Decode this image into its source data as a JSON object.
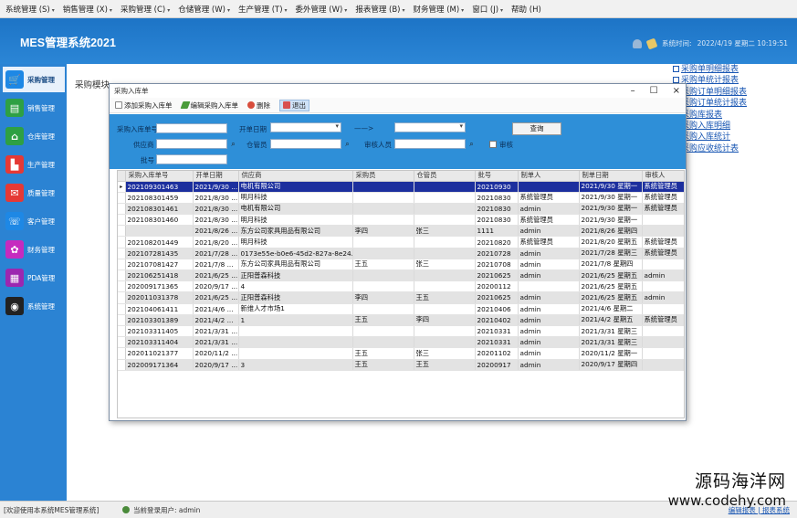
{
  "menu": [
    "系统管理 (S)",
    "销售管理 (X)",
    "采购管理 (C)",
    "仓储管理 (W)",
    "生产管理 (T)",
    "委外管理 (W)",
    "报表管理 (B)",
    "财务管理 (M)",
    "窗口 (J)",
    "帮助 (H)"
  ],
  "header": {
    "title": "MES管理系统2021",
    "login_label": "系统时间:",
    "datetime": "2022/4/19 星期二 10:19:51"
  },
  "sidebar": {
    "items": [
      {
        "label": "采购管理",
        "icon": "cart-icon",
        "color": "#1e88e5"
      },
      {
        "label": "销售管理",
        "icon": "document-icon",
        "color": "#2ea043"
      },
      {
        "label": "仓库管理",
        "icon": "home-icon",
        "color": "#2ea043"
      },
      {
        "label": "生产管理",
        "icon": "factory-icon",
        "color": "#e53935"
      },
      {
        "label": "质量管理",
        "icon": "mail-icon",
        "color": "#e53935"
      },
      {
        "label": "客户管理",
        "icon": "support-icon",
        "color": "#1e88e5"
      },
      {
        "label": "财务管理",
        "icon": "gift-icon",
        "color": "#c62bbf"
      },
      {
        "label": "PDA管理",
        "icon": "calculator-icon",
        "color": "#9c27b0"
      },
      {
        "label": "系统管理",
        "icon": "eye-icon",
        "color": "#222222"
      }
    ]
  },
  "main": {
    "heading": "采购模块",
    "right_links": [
      "采购单明细报表",
      "采购单统计报表",
      "采购订单明细报表",
      "采购订单统计报表",
      "采购库报表",
      "采购入库明细",
      "采购入库统计",
      "采购应收统计表"
    ]
  },
  "dialog": {
    "title": "采购入库单",
    "controls": [
      "–",
      "☐",
      "×"
    ],
    "toolbar": {
      "add": "添加采购入库单",
      "edit": "编辑采购入库单",
      "delete": "删除",
      "exit": "退出"
    },
    "filters": {
      "order_no_label": "采购入库单号",
      "date_label": "开单日期",
      "date_sep": "——>",
      "query_button": "查询",
      "supplier_label": "供应商",
      "warehouse_label": "仓管员",
      "reviewer_label": "审核人员",
      "audit_label": "审核",
      "batch_label": "批号"
    },
    "table": {
      "columns": [
        "采购入库单号",
        "开单日期",
        "供应商",
        "采购员",
        "仓管员",
        "批号",
        "制单人",
        "制单日期",
        "审核人"
      ],
      "rows": [
        [
          "202109301463",
          "2021/9/30 ...",
          "电机有限公司",
          "",
          "",
          "20210930",
          "",
          "2021/9/30 星期一",
          "系统管理员"
        ],
        [
          "202108301459",
          "2021/8/30 ...",
          "明月科技",
          "",
          "",
          "20210830",
          "系统管理员",
          "2021/9/30 星期一",
          "系统管理员"
        ],
        [
          "202108301461",
          "2021/8/30 ...",
          "电机有限公司",
          "",
          "",
          "20210830",
          "admin",
          "2021/9/30 星期一",
          "系统管理员"
        ],
        [
          "202108301460",
          "2021/8/30 ...",
          "明月科技",
          "",
          "",
          "20210830",
          "系统管理员",
          "2021/9/30 星期一",
          ""
        ],
        [
          "",
          "2021/8/26 ...",
          "东方公司家具用品有限公司",
          "李四",
          "张三",
          "1111",
          "admin",
          "2021/8/26 星期四",
          ""
        ],
        [
          "202108201449",
          "2021/8/20 ...",
          "明月科技",
          "",
          "",
          "20210820",
          "系统管理员",
          "2021/8/20 星期五",
          "系统管理员"
        ],
        [
          "202107281435",
          "2021/7/28 ...",
          "0173e55e-b0e6-45d2-827a-8e24...",
          "",
          "",
          "20210728",
          "admin",
          "2021/7/28 星期三",
          "系统管理员"
        ],
        [
          "202107081427",
          "2021/7/8 ...",
          "东方公司家具用品有限公司",
          "王五",
          "张三",
          "20210708",
          "admin",
          "2021/7/8 星期四",
          ""
        ],
        [
          "202106251418",
          "2021/6/25 ...",
          "正阳普森科技",
          "",
          "",
          "20210625",
          "admin",
          "2021/6/25 星期五",
          "admin"
        ],
        [
          "202009171365",
          "2020/9/17 ...",
          "4",
          "",
          "",
          "20200112",
          "",
          "2021/6/25 星期五",
          ""
        ],
        [
          "202011031378",
          "2021/6/25 ...",
          "正阳普森科技",
          "李四",
          "王五",
          "20210625",
          "admin",
          "2021/6/25 星期五",
          "admin"
        ],
        [
          "202104061411",
          "2021/4/6 ...",
          "新维人才市场1",
          "",
          "",
          "20210406",
          "admin",
          "2021/4/6 星期二",
          ""
        ],
        [
          "202103301389",
          "2021/4/2 ...",
          "1",
          "王五",
          "李四",
          "20210402",
          "admin",
          "2021/4/2 星期五",
          "系统管理员"
        ],
        [
          "202103311405",
          "2021/3/31 ...",
          "",
          "",
          "",
          "20210331",
          "admin",
          "2021/3/31 星期三",
          ""
        ],
        [
          "202103311404",
          "2021/3/31 ...",
          "",
          "",
          "",
          "20210331",
          "admin",
          "2021/3/31 星期三",
          ""
        ],
        [
          "202011021377",
          "2020/11/2 ...",
          "",
          "王五",
          "张三",
          "20201102",
          "admin",
          "2020/11/2 星期一",
          ""
        ],
        [
          "202009171364",
          "2020/9/17 ...",
          "3",
          "王五",
          "王五",
          "20200917",
          "admin",
          "2020/9/17 星期四",
          ""
        ]
      ],
      "selected_marker": "▸"
    }
  },
  "status": {
    "left": "[欢迎使用本系统MES管理系统]",
    "user": "当前登录用户: admin",
    "right": "编辑报表 | 报表系统"
  },
  "watermark": {
    "line1": "源码海洋网",
    "line2": "www.codehy.com"
  }
}
